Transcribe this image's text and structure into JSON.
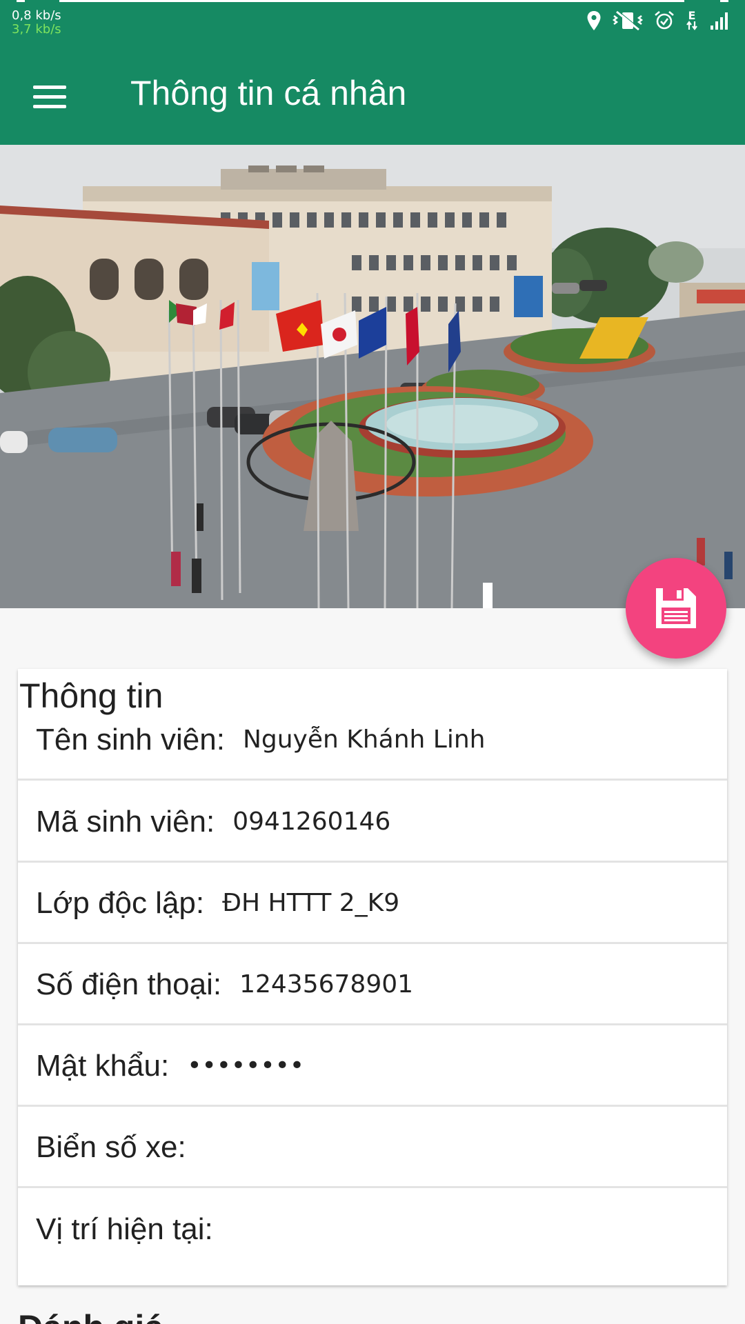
{
  "status_bar": {
    "upload_speed": "0,8 kb/s",
    "download_speed": "3,7 kb/s",
    "network_type": "E",
    "icons": [
      "location-icon",
      "vibrate-off-icon",
      "alarm-icon",
      "data-arrows-icon",
      "signal-icon"
    ]
  },
  "app_bar": {
    "title": "Thông tin cá nhân",
    "menu_icon": "hamburger-menu-icon"
  },
  "fab": {
    "icon": "save-floppy-icon",
    "color": "#f3437f"
  },
  "info_card": {
    "title": "Thông tin",
    "fields": [
      {
        "label": "Tên sinh viên:",
        "value": "Nguyễn Khánh Linh"
      },
      {
        "label": "Mã sinh viên:",
        "value": "0941260146"
      },
      {
        "label": "Lớp độc lập:",
        "value": "ĐH HTTT 2_K9"
      },
      {
        "label": "Số điện thoại:",
        "value": "12435678901"
      },
      {
        "label": "Mật khẩu:",
        "value": "••••••••"
      },
      {
        "label": "Biển số xe:",
        "value": ""
      },
      {
        "label": "Vị trí hiện tại:",
        "value": ""
      }
    ]
  },
  "next_section": {
    "title": "Đánh giá"
  },
  "colors": {
    "primary": "#168a63",
    "accent": "#f3437f",
    "background": "#f7f7f7"
  }
}
